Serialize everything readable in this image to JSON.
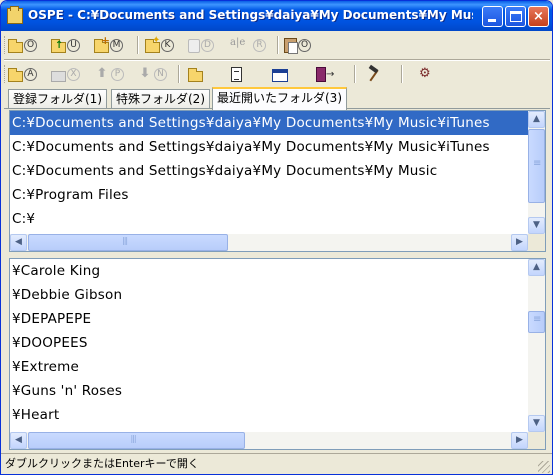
{
  "window": {
    "title": "OSPE - C:¥Documents and Settings¥daiya¥My Documents¥My Music¥iTunes",
    "buttons": {
      "minimize": "_",
      "maximize": "□",
      "close": "×"
    }
  },
  "toolbar1": {
    "items": [
      {
        "icon": "open-folder-icon",
        "key": "O",
        "enabled": true
      },
      {
        "icon": "parent-folder-icon",
        "key": "U",
        "enabled": true
      },
      {
        "icon": "new-folder-icon",
        "key": "M",
        "enabled": true
      },
      {
        "icon": "add-favorite-icon",
        "key": "K",
        "enabled": true
      },
      {
        "icon": "delete-icon",
        "key": "D",
        "enabled": false
      },
      {
        "icon": "rename-icon",
        "key": "R",
        "enabled": false
      },
      {
        "icon": "paste-icon",
        "key": "O",
        "enabled": true
      }
    ],
    "rename_glyph": "a|e"
  },
  "toolbar2": {
    "items": [
      {
        "icon": "open-folder-icon",
        "key": "A",
        "enabled": true
      },
      {
        "icon": "gray-folder-icon",
        "key": "X",
        "enabled": false
      },
      {
        "icon": "up-arrow-icon",
        "key": "P",
        "glyph": "⬆",
        "enabled": false
      },
      {
        "icon": "down-arrow-icon",
        "key": "N",
        "glyph": "⬇",
        "enabled": false
      }
    ],
    "tools": [
      "folder-icon",
      "document-icon",
      "window-icon",
      "exit-icon",
      "hammer-icon",
      "settings-tool-icon"
    ]
  },
  "tabs": [
    {
      "label": "登録フォルダ(1)",
      "active": false
    },
    {
      "label": "特殊フォルダ(2)",
      "active": false
    },
    {
      "label": "最近開いたフォルダ(3)",
      "active": true
    }
  ],
  "recent_folders": [
    {
      "path": "C:¥Documents and Settings¥daiya¥My Documents¥My Music¥iTunes",
      "selected": true
    },
    {
      "path": "C:¥Documents and Settings¥daiya¥My Documents¥My Music¥iTunes",
      "selected": false
    },
    {
      "path": "C:¥Documents and Settings¥daiya¥My Documents¥My Music",
      "selected": false
    },
    {
      "path": "C:¥Program Files",
      "selected": false
    },
    {
      "path": "C:¥",
      "selected": false
    }
  ],
  "subfolders": [
    "¥Carole King",
    "¥Debbie Gibson",
    "¥DEPAPEPE",
    "¥DOOPEES",
    "¥Extreme",
    "¥Guns 'n' Roses",
    "¥Heart"
  ],
  "statusbar": {
    "text": "ダブルクリックまたはEnterキーで開く"
  },
  "colors": {
    "titlebar": "#0058e6",
    "selection": "#316ac5",
    "active_tab_accent": "#ffc83c"
  }
}
